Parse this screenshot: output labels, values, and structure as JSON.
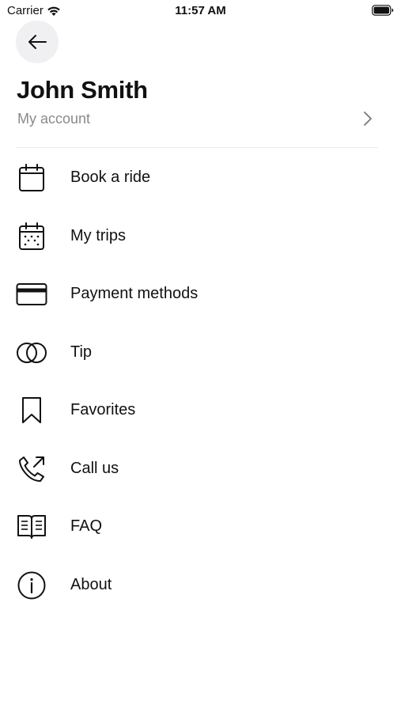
{
  "status_bar": {
    "carrier": "Carrier",
    "time": "11:57 AM"
  },
  "header": {
    "user_name": "John Smith",
    "account_link": "My account"
  },
  "menu": {
    "items": [
      {
        "label": "Book a ride",
        "icon": "calendar-icon"
      },
      {
        "label": "My trips",
        "icon": "calendar-dots-icon"
      },
      {
        "label": "Payment methods",
        "icon": "credit-card-icon"
      },
      {
        "label": "Tip",
        "icon": "overlapping-circles-icon"
      },
      {
        "label": "Favorites",
        "icon": "bookmark-icon"
      },
      {
        "label": "Call us",
        "icon": "phone-outgoing-icon"
      },
      {
        "label": "FAQ",
        "icon": "open-book-icon"
      },
      {
        "label": "About",
        "icon": "info-icon"
      }
    ]
  }
}
